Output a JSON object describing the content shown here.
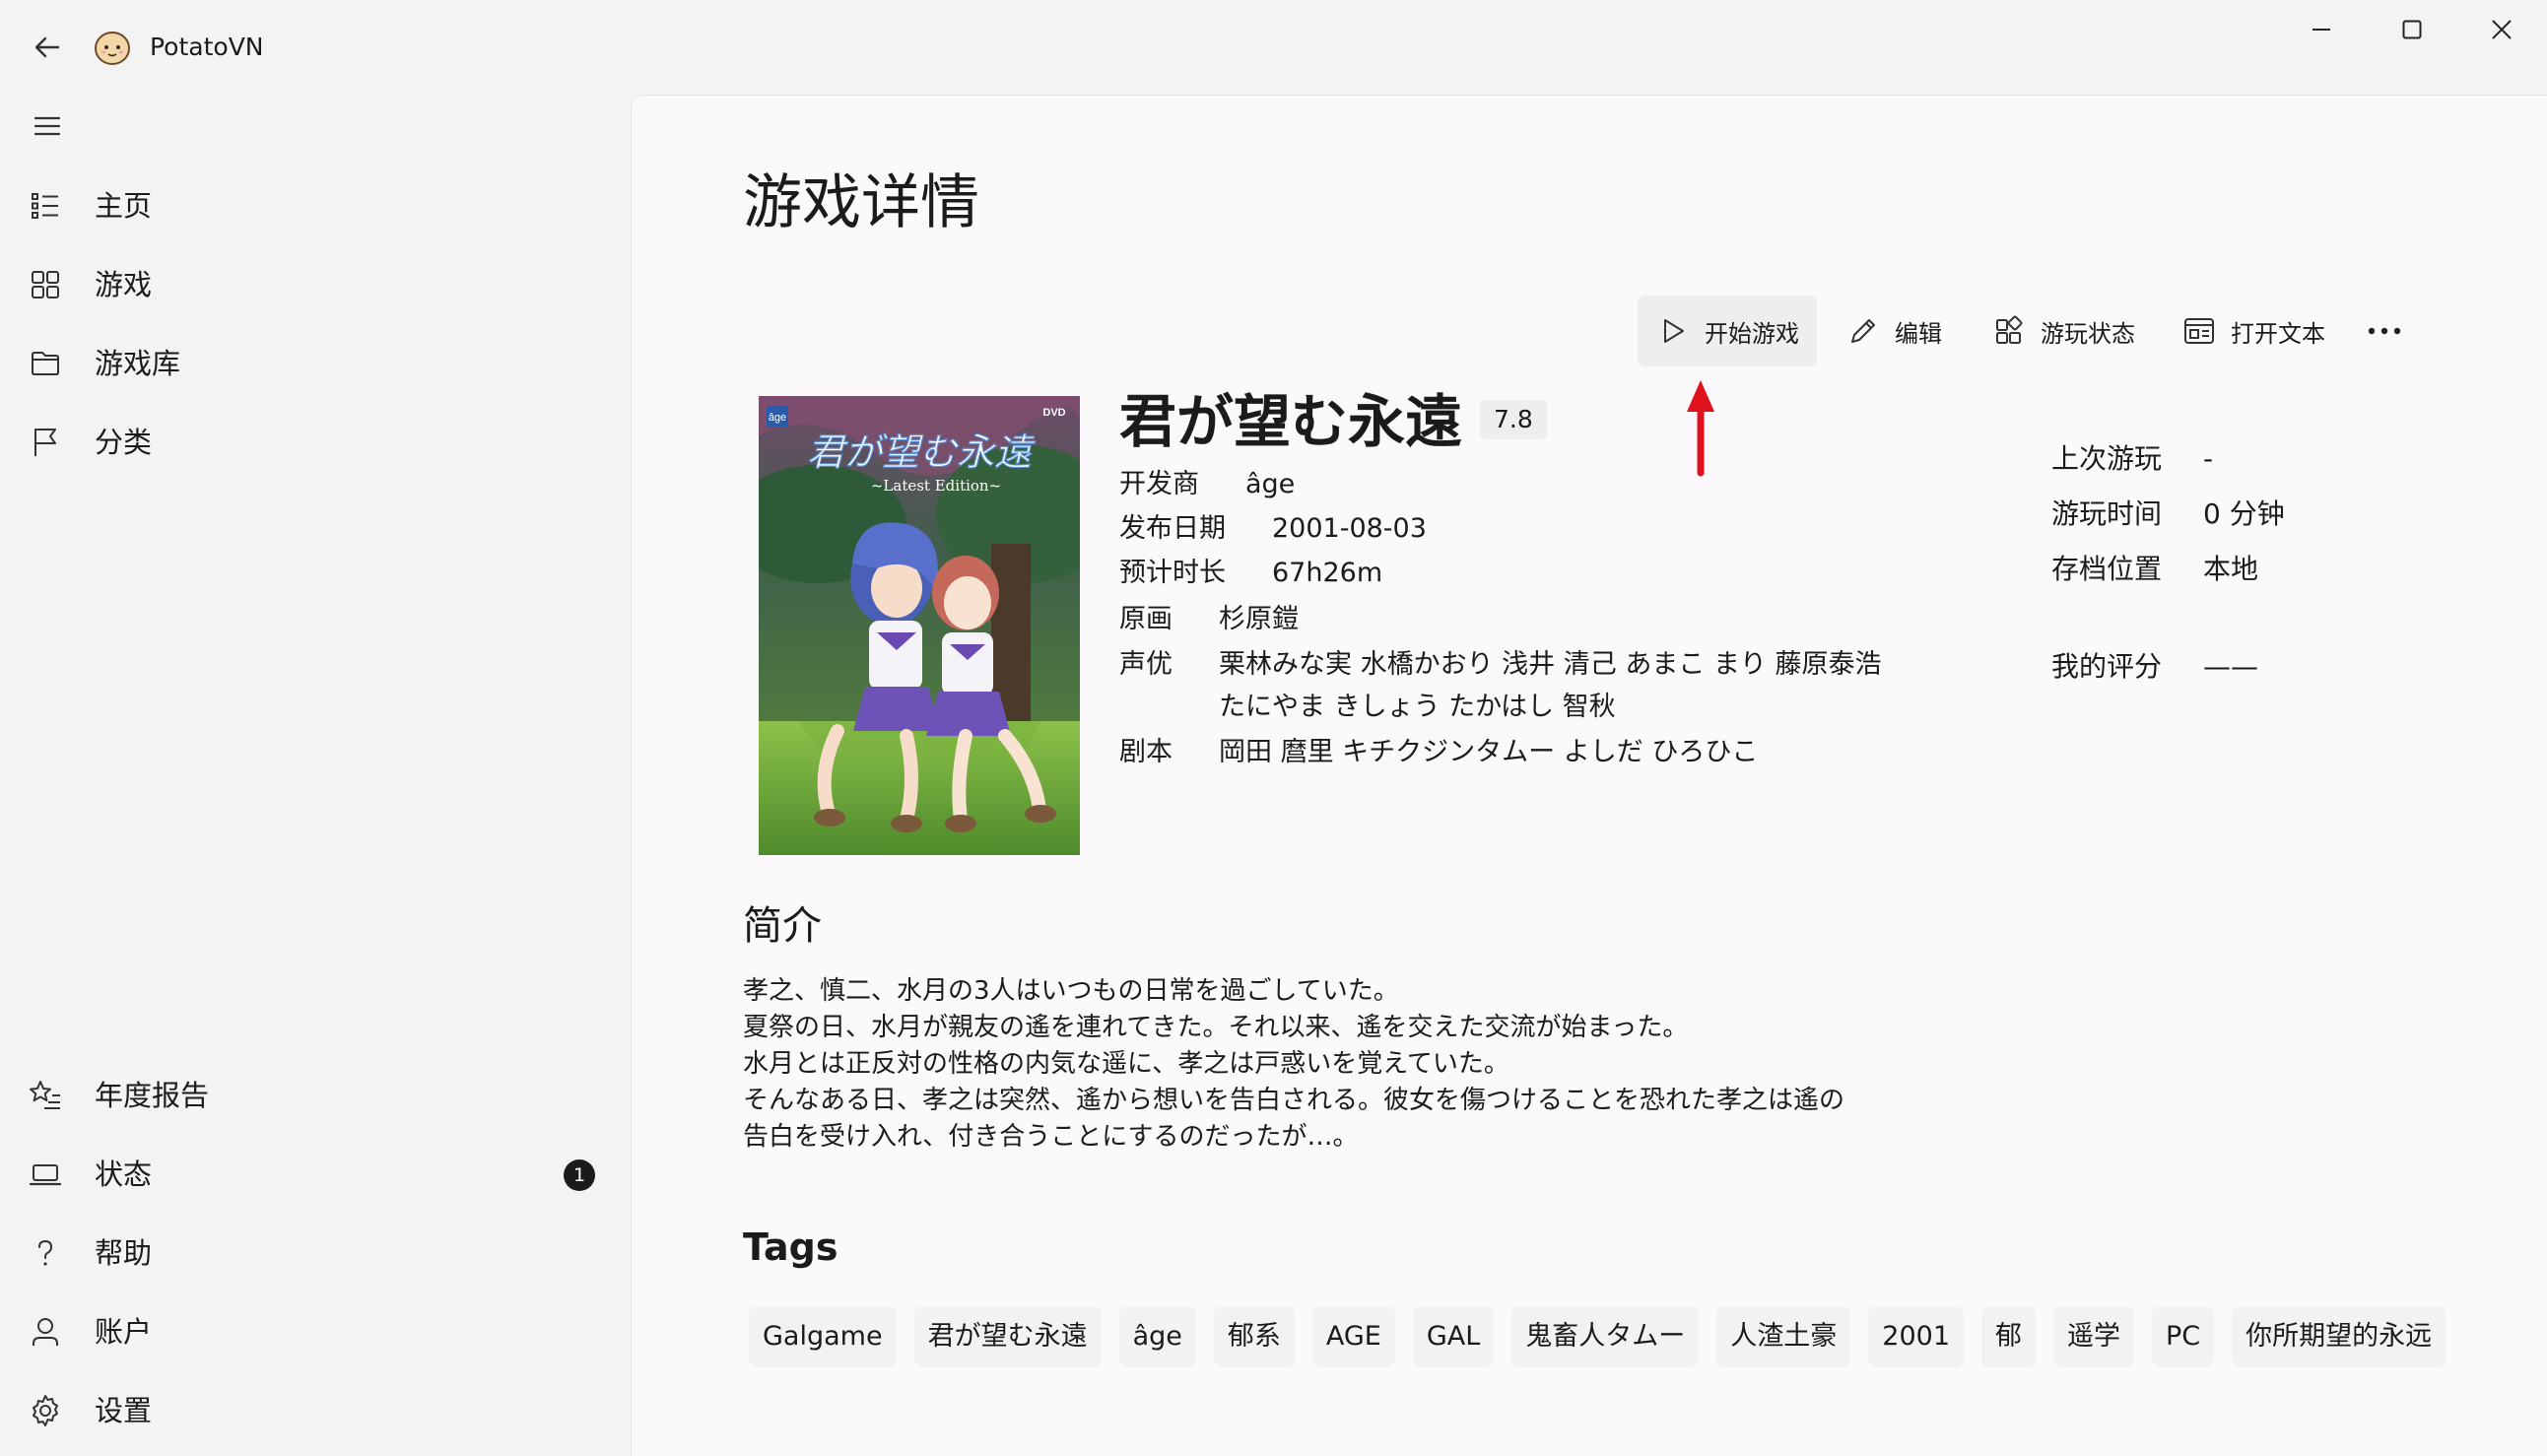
{
  "app": {
    "title": "PotatoVN"
  },
  "sidebar": {
    "items": [
      {
        "label": "主页",
        "icon": "home-list-icon"
      },
      {
        "label": "游戏",
        "icon": "grid-icon"
      },
      {
        "label": "游戏库",
        "icon": "folder-icon"
      },
      {
        "label": "分类",
        "icon": "flag-icon"
      }
    ],
    "footer_items": [
      {
        "label": "年度报告",
        "icon": "star-list-icon"
      },
      {
        "label": "状态",
        "icon": "laptop-icon",
        "badge": "1"
      },
      {
        "label": "帮助",
        "icon": "question-icon"
      },
      {
        "label": "账户",
        "icon": "person-icon"
      },
      {
        "label": "设置",
        "icon": "gear-icon"
      }
    ]
  },
  "page": {
    "title": "游戏详情"
  },
  "toolbar": {
    "play_label": "开始游戏",
    "edit_label": "编辑",
    "status_label": "游玩状态",
    "open_text_label": "打开文本",
    "more_label": "…"
  },
  "game": {
    "name": "君が望む永遠",
    "rating": "7.8",
    "developer_label": "开发商",
    "developer": "âge",
    "release_label": "发布日期",
    "release": "2001-08-03",
    "duration_label": "预计时长",
    "duration": "67h26m",
    "art_label": "原画",
    "art": "杉原鎧",
    "voice_label": "声优",
    "voice_line1": "栗林みな実  水橋かおり  浅井 清己  あまこ まり  藤原泰浩",
    "voice_line2": "たにやま きしょう  たかはし 智秋",
    "script_label": "剧本",
    "script": "岡田 麿里  キチクジンタムー  よしだ ひろひこ",
    "cover": {
      "logo": "âge",
      "dvd": "DVD",
      "title": "君が望む永遠",
      "subtitle": "~Latest Edition~"
    }
  },
  "stats": {
    "last_played_label": "上次游玩",
    "last_played": "-",
    "play_time_label": "游玩时间",
    "play_time": "0 分钟",
    "save_location_label": "存档位置",
    "save_location": "本地",
    "my_rating_label": "我的评分",
    "my_rating": "——"
  },
  "synopsis": {
    "title": "简介",
    "lines": [
      "孝之、慎二、水月の3人はいつもの日常を過ごしていた。",
      "夏祭の日、水月が親友の遙を連れてきた。それ以来、遙を交えた交流が始まった。",
      "水月とは正反対の性格の内気な遥に、孝之は戸惑いを覚えていた。",
      "そんなある日、孝之は突然、遙から想いを告白される。彼女を傷つけることを恐れた孝之は遙の",
      "告白を受け入れ、付き合うことにするのだったが…。"
    ]
  },
  "tags": {
    "title": "Tags",
    "items": [
      "Galgame",
      "君が望む永遠",
      "âge",
      "郁系",
      "AGE",
      "GAL",
      "鬼畜人タムー",
      "人渣土豪",
      "2001",
      "郁",
      "遥学",
      "PC",
      "你所期望的永远"
    ]
  },
  "colors": {
    "accent_arrow": "#e0121b",
    "badge": "#1b1b1b"
  }
}
